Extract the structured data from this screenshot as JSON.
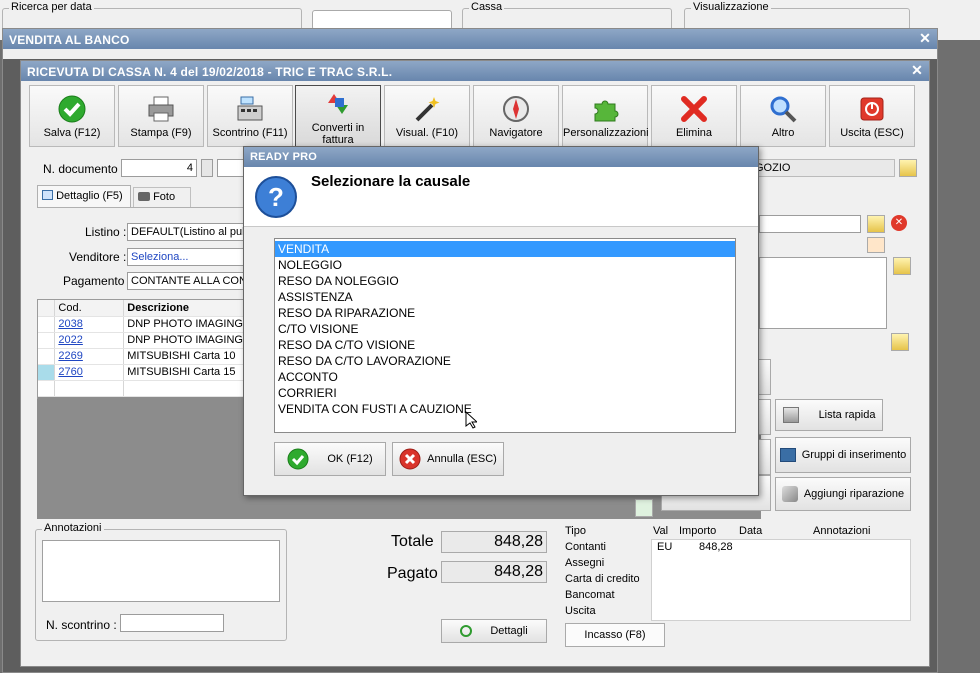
{
  "background": {
    "group1": "Ricerca per data",
    "group2": "Cassa",
    "group3": "Visualizzazione"
  },
  "outer_window": {
    "title": "VENDITA AL BANCO"
  },
  "receipt": {
    "title": "RICEVUTA DI CASSA N. 4 del 19/02/2018 - TRIC E TRAC S.R.L.",
    "toolbar": [
      {
        "label": "Salva (F12)",
        "icon": "check-icon"
      },
      {
        "label": "Stampa (F9)",
        "icon": "printer-icon"
      },
      {
        "label": "Scontrino (F11)",
        "icon": "cash-register-icon"
      },
      {
        "label": "Converti in fattura",
        "icon": "convert-icon"
      },
      {
        "label": "Visual. (F10)",
        "icon": "magic-wand-icon"
      },
      {
        "label": "Navigatore",
        "icon": "compass-icon"
      },
      {
        "label": "Personalizzazioni",
        "icon": "puzzle-icon"
      },
      {
        "label": "Elimina",
        "icon": "delete-icon"
      },
      {
        "label": "Altro",
        "icon": "search-icon"
      },
      {
        "label": "Uscita (ESC)",
        "icon": "exit-icon"
      }
    ],
    "n_documento_label": "N. documento :",
    "n_documento_value": "4",
    "negozio_value": "GOZIO",
    "tab_dettaglio": "Dettaglio (F5)",
    "tab_foto": "Foto",
    "listino_label": "Listino :",
    "listino_value": "DEFAULT(Listino al pubb",
    "venditore_label": "Venditore :",
    "venditore_value": "Seleziona...",
    "pagamento_label": "Pagamento :",
    "pagamento_value": "CONTANTE ALLA CONSE",
    "grid_headers": {
      "cod": "Cod.",
      "descrizione": "Descrizione"
    },
    "rows": [
      {
        "cod": "2038",
        "descrizione": "DNP PHOTO IMAGING"
      },
      {
        "cod": "2022",
        "descrizione": "DNP PHOTO IMAGING"
      },
      {
        "cod": "2269",
        "descrizione": "MITSUBISHI Carta 10"
      },
      {
        "cod": "2760",
        "descrizione": "MITSUBISHI Carta 15"
      }
    ],
    "annotazioni_label": "Annotazioni",
    "n_scontrino_label": "N. scontrino :",
    "totale_label": "Totale",
    "totale_value": "848,28",
    "pagato_label": "Pagato",
    "pagato_value": "848,28",
    "dettagli_label": "Dettagli",
    "lista_rapida_label": "Lista rapida",
    "gruppi_label": "Gruppi di inserimento",
    "aggiungi_label": "Aggiungi riparazione",
    "payments": {
      "headers": {
        "tipo": "Tipo",
        "val": "Val",
        "importo": "Importo",
        "data": "Data",
        "annotazioni": "Annotazioni"
      },
      "rows": [
        {
          "tipo": "Contanti",
          "val": "EU",
          "importo": "848,28"
        },
        {
          "tipo": "Assegni",
          "val": "",
          "importo": ""
        },
        {
          "tipo": "Carta di credito",
          "val": "",
          "importo": ""
        },
        {
          "tipo": "Bancomat",
          "val": "",
          "importo": ""
        },
        {
          "tipo": "Uscita",
          "val": "",
          "importo": ""
        }
      ]
    },
    "incasso_tab": "Incasso (F8)"
  },
  "dialog": {
    "title": "READY PRO",
    "heading": "Selezionare la causale",
    "options": [
      "VENDITA",
      "NOLEGGIO",
      "RESO DA NOLEGGIO",
      "ASSISTENZA",
      "RESO DA RIPARAZIONE",
      "C/TO VISIONE",
      "RESO DA C/TO VISIONE",
      "RESO DA C/TO LAVORAZIONE",
      "ACCONTO",
      "CORRIERI",
      "VENDITA CON FUSTI A CAUZIONE"
    ],
    "selected": "VENDITA",
    "ok_label": "OK (F12)",
    "cancel_label": "Annulla (ESC)"
  },
  "colors": {
    "title_bar": "#6886ad",
    "selection": "#3399ff",
    "ok_green": "#2faa2f",
    "cancel_red": "#d9342b"
  }
}
